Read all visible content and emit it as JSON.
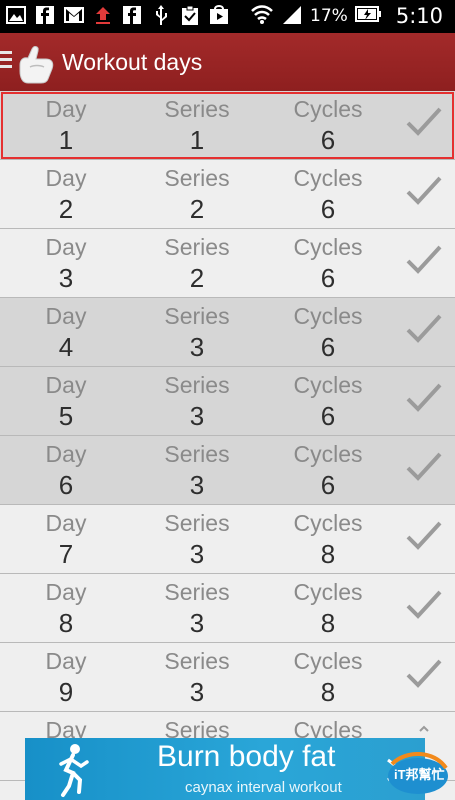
{
  "status_bar": {
    "battery_percent": "17%",
    "time": "5:10",
    "left_icons": [
      "gallery-icon",
      "facebook-icon",
      "gmail-icon",
      "upload-icon",
      "facebook-icon",
      "usb-icon",
      "clipboard-check-icon",
      "play-store-icon"
    ],
    "right_icons": [
      "wifi-icon",
      "signal-icon",
      "battery-icon"
    ]
  },
  "action_bar": {
    "title": "Workout days",
    "accent": "#9b2626"
  },
  "list": {
    "labels": {
      "day": "Day",
      "series": "Series",
      "cycles": "Cycles"
    },
    "rows": [
      {
        "day": "1",
        "series": "1",
        "cycles": "6",
        "completed": true,
        "selected": true
      },
      {
        "day": "2",
        "series": "2",
        "cycles": "6",
        "completed": false,
        "selected": false
      },
      {
        "day": "3",
        "series": "2",
        "cycles": "6",
        "completed": false,
        "selected": false
      },
      {
        "day": "4",
        "series": "3",
        "cycles": "6",
        "completed": true,
        "selected": false
      },
      {
        "day": "5",
        "series": "3",
        "cycles": "6",
        "completed": true,
        "selected": false
      },
      {
        "day": "6",
        "series": "3",
        "cycles": "6",
        "completed": true,
        "selected": false
      },
      {
        "day": "7",
        "series": "3",
        "cycles": "8",
        "completed": false,
        "selected": false
      },
      {
        "day": "8",
        "series": "3",
        "cycles": "8",
        "completed": false,
        "selected": false
      },
      {
        "day": "9",
        "series": "3",
        "cycles": "8",
        "completed": false,
        "selected": false
      }
    ],
    "partial_row": {
      "day": "Day",
      "series": "Series",
      "cycles": "Cycles"
    }
  },
  "ad": {
    "title": "Burn body fat",
    "subtitle": "caynax interval workout",
    "background": "#1e9bd0"
  },
  "watermark": {
    "text": "iT邦幫忙"
  }
}
